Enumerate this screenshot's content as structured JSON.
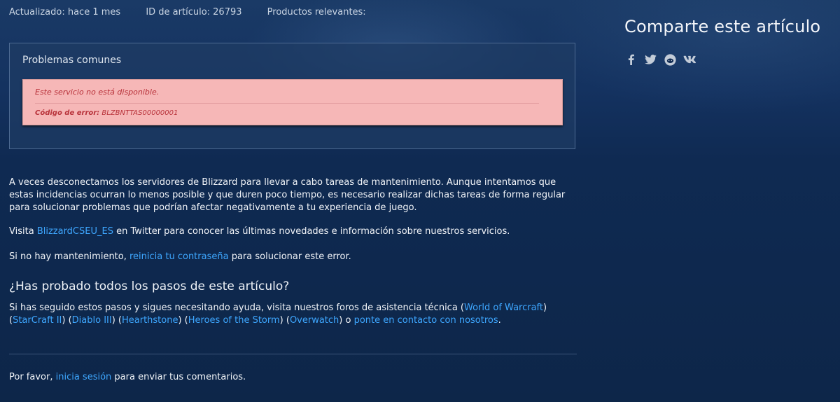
{
  "meta": {
    "updated": "Actualizado: hace 1 mes",
    "article_id": "ID de artículo: 26793",
    "products": "Productos relevantes:"
  },
  "share": {
    "title": "Comparte este artículo",
    "icons": [
      "facebook-icon",
      "twitter-icon",
      "reddit-icon",
      "vk-icon"
    ]
  },
  "panel": {
    "title": "Problemas comunes",
    "error_message": "Este servicio no está disponible.",
    "error_code_label": "Código de error:",
    "error_code_value": "BLZBNTTAS00000001"
  },
  "paragraphs": {
    "p1": "A veces desconectamos los servidores de Blizzard para llevar a cabo tareas de mantenimiento. Aunque intentamos que estas incidencias ocurran lo menos posible y que duren poco tiempo, es necesario realizar dichas tareas de forma regular para solucionar problemas que podrían afectar negativamente a tu experiencia de juego.",
    "p2_before": "Visita ",
    "p2_link": "BlizzardCSEU_ES",
    "p2_after": " en Twitter para conocer las últimas novedades e información sobre nuestros servicios.",
    "p3_before": "Si no hay mantenimiento, ",
    "p3_link": "reinicia tu contraseña",
    "p3_after": " para solucionar este error."
  },
  "steps": {
    "heading": "¿Has probado todos los pasos de este artículo?",
    "intro": "Si has seguido estos pasos y sigues necesitando ayuda, visita nuestros foros de asistencia técnica (",
    "links": {
      "wow": "World of Warcraft",
      "sc2": "StarCraft II",
      "d3": "Diablo III",
      "hs": "Hearthstone",
      "hots": "Heroes of the Storm",
      "ow": "Overwatch",
      "contact": "ponte en contacto con nosotros"
    },
    "sep_close_open": ") (",
    "close_paren": ")",
    "or_text": " o ",
    "period": "."
  },
  "feedback": {
    "before": "Por favor, ",
    "link": "inicia sesión",
    "after": " para enviar tus comentarios."
  },
  "colors": {
    "link": "#3ea7ff",
    "error_bg": "#f6b7b7",
    "error_text": "#b8323a"
  }
}
